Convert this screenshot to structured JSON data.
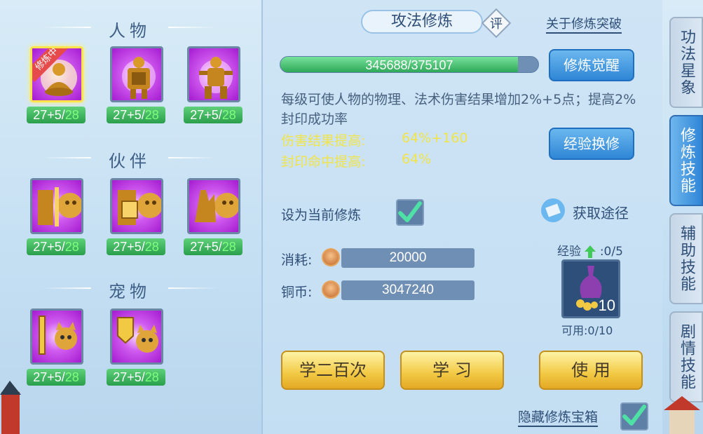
{
  "left": {
    "sections": [
      {
        "title": "人物",
        "skills": [
          {
            "icon": "monk-meditate-icon",
            "level": "27+5/",
            "max": "28",
            "tag": "修炼中",
            "selected": true
          },
          {
            "icon": "warrior-shield-icon",
            "level": "27+5/",
            "max": "28",
            "selected": false
          },
          {
            "icon": "warrior-stance-icon",
            "level": "27+5/",
            "max": "28",
            "selected": false
          }
        ]
      },
      {
        "title": "伙伴",
        "skills": [
          {
            "icon": "lion-sword-icon",
            "level": "27+5/",
            "max": "28"
          },
          {
            "icon": "lion-shield-icon",
            "level": "27+5/",
            "max": "28"
          },
          {
            "icon": "lion-palm-icon",
            "level": "27+5/",
            "max": "28"
          }
        ]
      },
      {
        "title": "宠物",
        "skills": [
          {
            "icon": "cat-sword-icon",
            "level": "27+5/",
            "max": "28"
          },
          {
            "icon": "cat-shield-icon",
            "level": "27+5/",
            "max": "28"
          }
        ]
      }
    ]
  },
  "header": {
    "title": "攻法修炼",
    "rate": "评",
    "link": "关于修炼突破"
  },
  "progress": {
    "text": "345688/375107",
    "fraction": 0.9216
  },
  "buttons": {
    "awaken": "修炼觉醒",
    "exchange": "经验换修",
    "study200": "学二百次",
    "study": "学 习",
    "use": "使 用"
  },
  "description": "每级可使人物的物理、法术伤害结果增加2%+5点；提高2%封印成功率",
  "stats": [
    {
      "label": "伤害结果提高:",
      "value": "64%+160"
    },
    {
      "label": "封印命中提高:",
      "value": "64%"
    }
  ],
  "set_current": "设为当前修炼",
  "get_path": "获取途径",
  "cost": {
    "label": "消耗:",
    "value": "20000"
  },
  "coins": {
    "label": "铜币:",
    "value": "3047240"
  },
  "exp": {
    "label": "经验",
    "count": ":0/5",
    "item_count": "10",
    "available": "可用:0/10"
  },
  "hide_box": "隐藏修炼宝箱",
  "tabs": [
    {
      "label": "功法星象",
      "active": false
    },
    {
      "label": "修炼技能",
      "active": true
    },
    {
      "label": "辅助技能",
      "active": false
    },
    {
      "label": "剧情技能",
      "active": false
    }
  ],
  "colors": {
    "accent": "#2f86d6",
    "gold": "#f2c943",
    "stat_yellow": "#f0e44a"
  }
}
